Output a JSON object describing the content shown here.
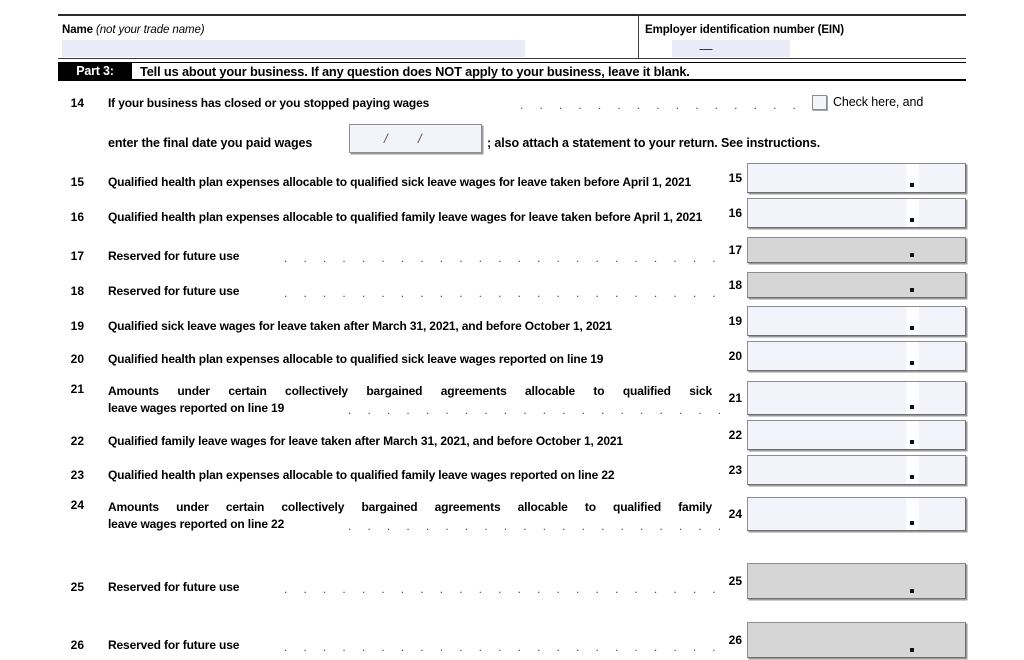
{
  "form": {
    "header": {
      "name_label_bold": "Name",
      "name_label_italic": "(not your trade name)",
      "ein_label": "Employer identification number (EIN)",
      "ein_separator": "—",
      "name_value": "",
      "ein_value": ""
    },
    "part": {
      "tag": "Part 3:",
      "title": "Tell us about your business. If any question does NOT apply to your business, leave it blank."
    },
    "line14": {
      "number": "14",
      "text": "If your business has closed or you stopped paying wages",
      "checkbox_label": "Check here, and",
      "checkbox_checked": false,
      "continuation_text": "enter the final date you paid wages",
      "date_value": "",
      "date_sep1": "/",
      "date_sep2": "/",
      "tail_text": "; also attach a statement to your return. See instructions."
    },
    "lines": [
      {
        "number": "15",
        "text": "Qualified health plan expenses allocable to qualified sick leave wages for leave taken before April 1, 2021",
        "leader": false,
        "reserved": false,
        "value": ""
      },
      {
        "number": "16",
        "text": "Qualified health plan expenses allocable to qualified family leave wages for leave taken before April 1, 2021",
        "leader": false,
        "reserved": false,
        "value": ""
      },
      {
        "number": "17",
        "text": "Reserved for future use",
        "leader": true,
        "reserved": true,
        "value": ""
      },
      {
        "number": "18",
        "text": "Reserved for future use",
        "leader": true,
        "reserved": true,
        "value": ""
      },
      {
        "number": "19",
        "text": "Qualified sick leave wages for leave taken after March 31, 2021, and before October 1, 2021",
        "leader": false,
        "reserved": false,
        "value": ""
      },
      {
        "number": "20",
        "text": "Qualified health plan expenses allocable to qualified sick leave wages reported on line 19",
        "leader": false,
        "reserved": false,
        "value": ""
      },
      {
        "number": "21",
        "text_line1": "Amounts under certain collectively bargained agreements allocable to qualified sick",
        "text_line2": "leave wages reported on line 19",
        "leader": true,
        "reserved": false,
        "value": ""
      },
      {
        "number": "22",
        "text": "Qualified family leave wages for leave taken after March 31, 2021, and before October 1, 2021",
        "leader": false,
        "reserved": false,
        "value": ""
      },
      {
        "number": "23",
        "text": "Qualified health plan expenses allocable to qualified family leave wages reported on line 22",
        "leader": false,
        "reserved": false,
        "value": ""
      },
      {
        "number": "24",
        "text_line1": "Amounts under certain collectively bargained agreements allocable to qualified family",
        "text_line2": "leave wages reported on line 22",
        "leader": true,
        "reserved": false,
        "value": ""
      },
      {
        "number": "25",
        "text": "Reserved for future use",
        "leader": true,
        "reserved": true,
        "value": ""
      },
      {
        "number": "26",
        "text": "Reserved for future use",
        "leader": true,
        "reserved": true,
        "value": ""
      }
    ],
    "leader_dots": ".  .  .  .  .  .  .  .  .  .  .  .  .  .  .  .  .  .  .  .  .  .  .  .  .  .  .  ."
  }
}
